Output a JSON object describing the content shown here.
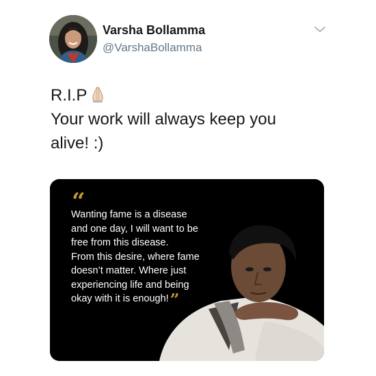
{
  "author": {
    "display_name": "Varsha Bollamma",
    "handle": "@VarshaBollamma"
  },
  "tweet": {
    "line1": "R.I.P",
    "line2": "Your work will always keep you",
    "line3": "alive! :)"
  },
  "icons": {
    "emoji": "folded-hands-icon",
    "menu": "chevron-down-icon",
    "open_quote": "“",
    "close_quote": "”"
  },
  "media": {
    "quote_lines": [
      "Wanting fame is a disease",
      "and one day, I will want to be",
      "free from this disease.",
      "From this desire, where fame",
      "doesn’t matter. Where just",
      "experiencing life and being",
      "okay with it is enough!"
    ]
  },
  "colors": {
    "name": "#14171a",
    "handle": "#657786",
    "quote_accent": "#c49a2c",
    "media_background": "#000000"
  }
}
